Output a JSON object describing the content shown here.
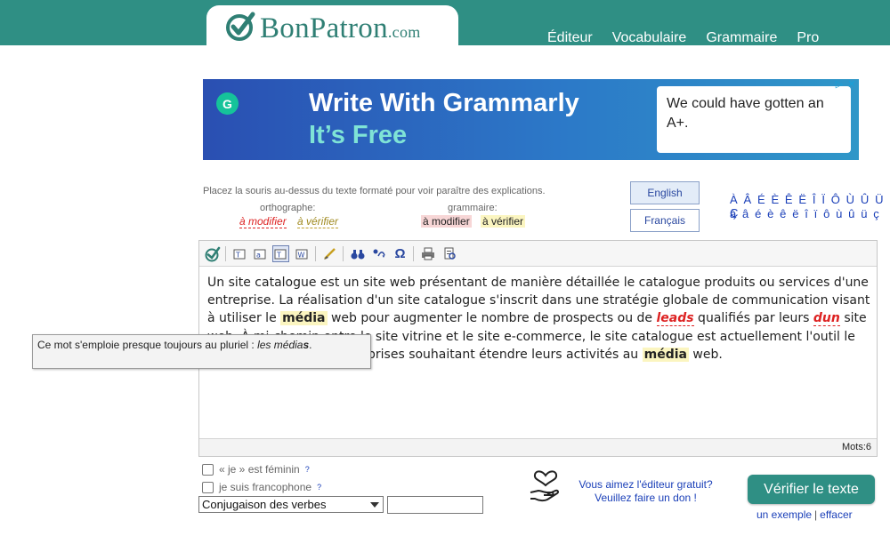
{
  "header": {
    "logo_name": "BonPatron",
    "logo_suffix": ".com",
    "nav": [
      "Éditeur",
      "Vocabulaire",
      "Grammaire",
      "Pro"
    ]
  },
  "ad": {
    "title": "Write With Grammarly",
    "subtitle": "It’s Free",
    "box_text": "We could have gotten an A+.",
    "g_letter": "G"
  },
  "instructions": {
    "hint": "Placez la souris au-dessus du texte formaté pour voir paraître des explications.",
    "orthographe_label": "orthographe:",
    "grammaire_label": "grammaire:",
    "ortho_modifier": "à modifier",
    "ortho_verifier": "à vérifier",
    "gram_modifier": "à modifier",
    "gram_verifier": "à vérifier"
  },
  "language": {
    "english": "English",
    "francais": "Français",
    "selected": "English"
  },
  "accents": {
    "upper": "À Â É È Ê Ë Î Ï Ô Ù Û Ü Ç",
    "lower": "à â é è ê ë î ï ô ù û ü ç"
  },
  "editor": {
    "text_1": "Un site catalogue est un site web présentant de manière détaillée le catalogue produits ou services d'une entreprise. La réalisation d'un site catalogue s'inscrit dans une stratégie globale de communication visant à utiliser le ",
    "hl_1": "média",
    "text_2": " web pour augmenter le nombre de prospects ou de ",
    "err_1": "leads",
    "text_3": " qualifiés par leurs ",
    "err_2": "dun",
    "text_4": " site web. À mi-chemin entre le site vitrine et le site e-commerce, le site catalogue est actuellement l'outil le plus sollicité par les entreprises souhaitant étendre leurs activités au ",
    "hl_2": "média",
    "text_5": " web.",
    "word_count": "Mots:6"
  },
  "tooltip": {
    "text": "Ce mot s'emploie presque toujours au pluriel : ",
    "example_stem": "les média",
    "example_bold": "s",
    "end": "."
  },
  "options": {
    "feminine": "« je » est féminin",
    "francophone": "je suis francophone",
    "help_mark": "?",
    "conjugation_select": "Conjugaison des verbes",
    "conjugation_input": ""
  },
  "donate": {
    "line1": "Vous aimez l'éditeur gratuit?",
    "line2": "Veuillez faire un don !"
  },
  "actions": {
    "verify": "Vérifier le texte",
    "example": "un exemple",
    "clear": "effacer",
    "separator": "|"
  },
  "colors": {
    "brand": "#2f8f84",
    "link": "#1a3fb8",
    "error_red": "#d22222",
    "highlight_yellow": "#fbf5c0"
  }
}
